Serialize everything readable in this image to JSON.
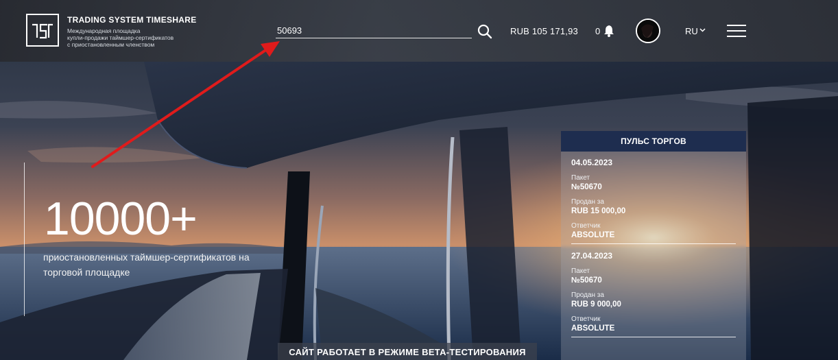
{
  "brand": {
    "title": "TRADING SYSTEM TIMESHARE",
    "subtitle_line1": "Международная площадка",
    "subtitle_line2": "купли-продажи таймшер-сертификатов",
    "subtitle_line3": "с приостановленным членством",
    "logo_icon": "tst-logo-icon"
  },
  "header": {
    "search_value": "50693",
    "search_icon": "search-icon",
    "balance": "RUB 105 171,93",
    "notifications_count": "0",
    "bell_icon": "bell-icon",
    "language": "RU",
    "menu_icon": "hamburger-menu-icon"
  },
  "hero": {
    "number": "10000+",
    "text": "приостановленных таймшер-сертификатов на торговой площадке"
  },
  "pulse": {
    "title": "ПУЛЬС ТОРГОВ",
    "trades": [
      {
        "date": "04.05.2023",
        "package_label": "Пакет",
        "package_value": "№50670",
        "sold_label": "Продан за",
        "sold_value": "RUB 15 000,00",
        "resort_label": "Ответчик",
        "resort_value": "ABSOLUTE"
      },
      {
        "date": "27.04.2023",
        "package_label": "Пакет",
        "package_value": "№50670",
        "sold_label": "Продан за",
        "sold_value": "RUB 9 000,00",
        "resort_label": "Ответчик",
        "resort_value": "ABSOLUTE"
      }
    ]
  },
  "beta_banner": "САЙТ РАБОТАЕТ В РЕЖИМЕ BETA-ТЕСТИРОВАНИЯ",
  "colors": {
    "pulse_header": "#1e2d4f",
    "annotation_arrow": "#e01b1b"
  }
}
